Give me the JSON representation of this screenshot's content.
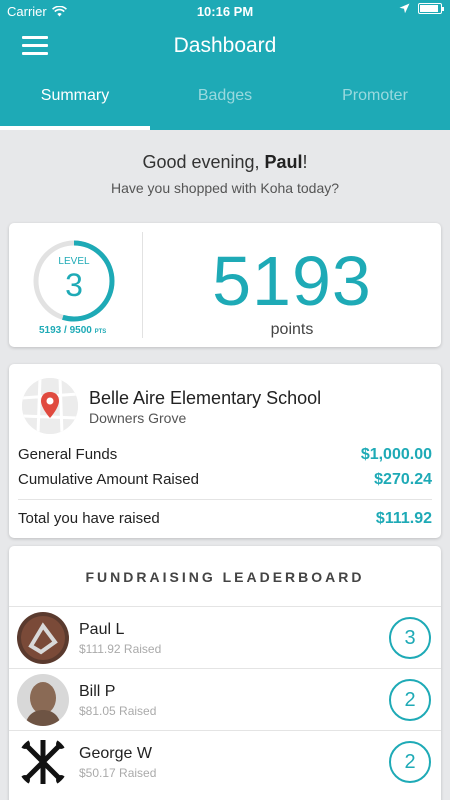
{
  "status_bar": {
    "carrier": "Carrier",
    "time": "10:16 PM"
  },
  "header": {
    "title": "Dashboard"
  },
  "tabs": [
    {
      "label": "Summary",
      "active": true
    },
    {
      "label": "Badges",
      "active": false
    },
    {
      "label": "Promoter",
      "active": false
    }
  ],
  "greeting": {
    "prefix": "Good evening, ",
    "name": "Paul",
    "suffix": "!",
    "subtitle": "Have you shopped with Koha today?"
  },
  "level_card": {
    "level_label": "LEVEL",
    "level": "3",
    "points_progress": "5193 / 9500",
    "points_unit": "PTS",
    "progress_fraction": 0.547,
    "points": "5193",
    "points_label": "points"
  },
  "school": {
    "name": "Belle Aire Elementary School",
    "city": "Downers Grove",
    "funds": [
      {
        "label": "General Funds",
        "amount": "$1,000.00"
      },
      {
        "label": "Cumulative Amount Raised",
        "amount": "$270.24"
      }
    ],
    "total": {
      "label": "Total you have raised",
      "amount": "$111.92"
    }
  },
  "leaderboard": {
    "title": "FUNDRAISING LEADERBOARD",
    "entries": [
      {
        "name": "Paul L",
        "raised": "$111.92 Raised",
        "rank": "3"
      },
      {
        "name": "Bill P",
        "raised": "$81.05 Raised",
        "rank": "2"
      },
      {
        "name": "George W",
        "raised": "$50.17 Raised",
        "rank": "2"
      }
    ]
  },
  "colors": {
    "accent": "#1eaab6",
    "background": "#e7e8ea",
    "pin": "#e04a3f"
  }
}
